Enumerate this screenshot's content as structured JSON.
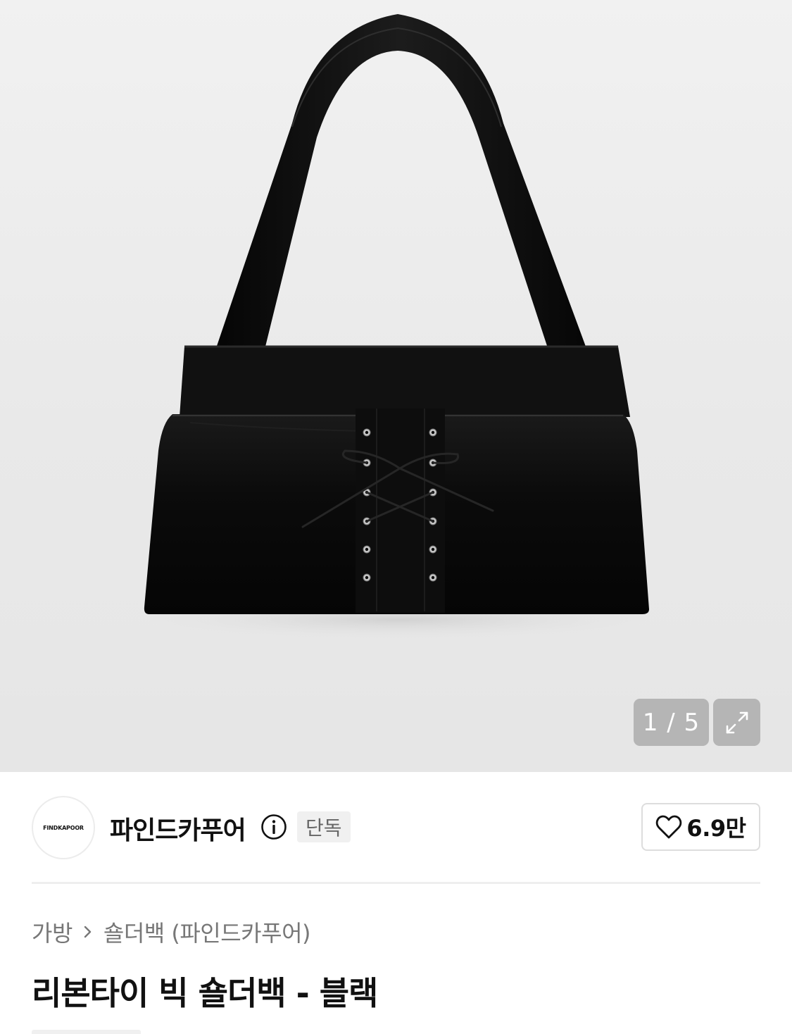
{
  "gallery": {
    "image_alt": "리본타이 빅 숄더백 - 블랙",
    "current_index": 1,
    "total": 5,
    "counter_text": "1 / 5",
    "expand_icon": "expand-arrows-icon"
  },
  "brand": {
    "logo_text": "FINDKAPOOR",
    "name": "파인드카푸어",
    "info_icon": "info-circle-icon",
    "badge": "단독"
  },
  "like": {
    "icon": "heart-outline-icon",
    "count": "6.9만"
  },
  "breadcrumb": {
    "items": [
      "가방",
      "숄더백 (파인드카푸어)"
    ],
    "separator_icon": "chevron-right-icon"
  },
  "product": {
    "title": "리본타이 빅 숄더백 - 블랙"
  },
  "colors": {
    "background": "#ffffff",
    "gallery_bg": "#ececec",
    "bag": "#0c0c0c",
    "text_primary": "#111111",
    "text_secondary": "#777777",
    "badge_bg": "#f0f0f0"
  }
}
